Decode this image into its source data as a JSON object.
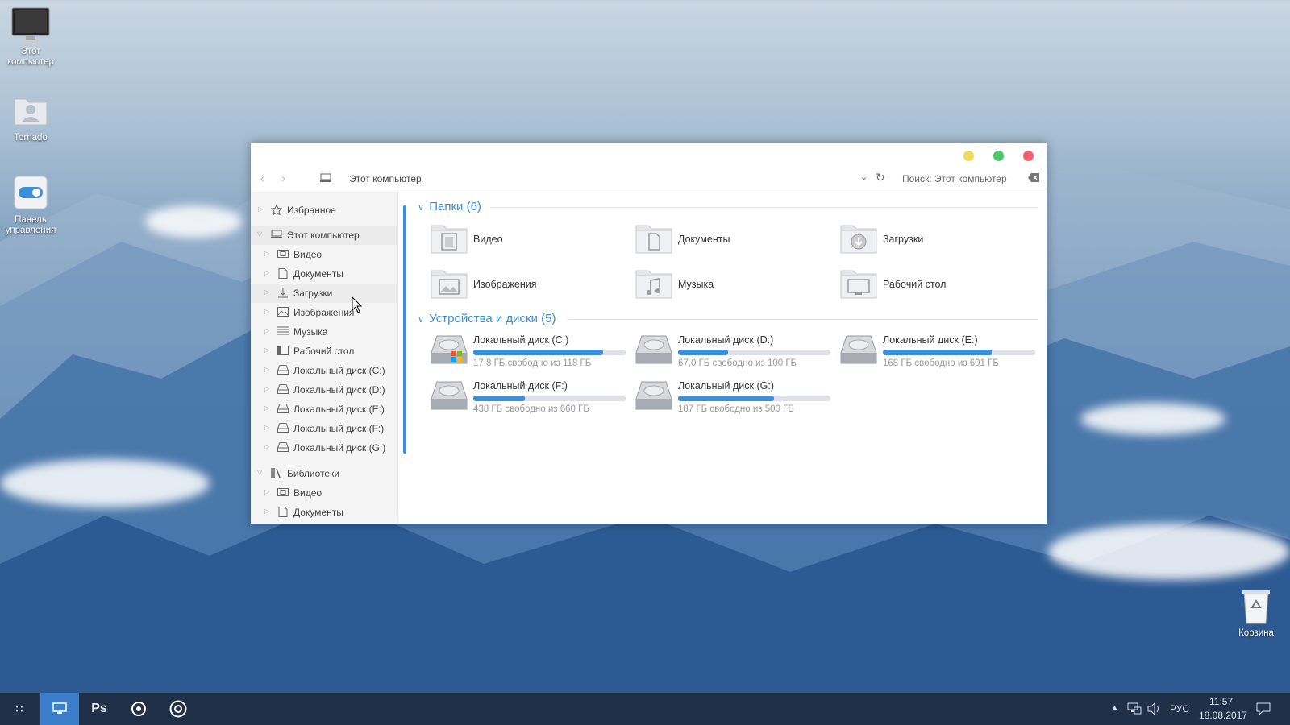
{
  "desktop": {
    "icons": [
      {
        "label": "Этот компьютер",
        "icon": "monitor-icon"
      },
      {
        "label": "Tornado",
        "icon": "user-folder-icon"
      },
      {
        "label": "Панель управления",
        "icon": "control-panel-toggle-icon"
      },
      {
        "label": "Корзина",
        "icon": "recycle-bin-icon"
      }
    ]
  },
  "window": {
    "controls": {
      "minimize_color": "#f1d95c",
      "maximize_color": "#4cc76a",
      "close_color": "#f0616d"
    },
    "address": "Этот компьютер",
    "search_placeholder": "Поиск: Этот компьютер"
  },
  "sidebar": {
    "items": [
      {
        "label": "Избранное",
        "icon": "star-icon",
        "level": 0
      },
      {
        "label": "Этот компьютер",
        "icon": "computer-icon",
        "level": 0,
        "expanded": true,
        "selected": true
      },
      {
        "label": "Видео",
        "icon": "film-icon",
        "level": 1
      },
      {
        "label": "Документы",
        "icon": "document-icon",
        "level": 1
      },
      {
        "label": "Загрузки",
        "icon": "download-icon",
        "level": 1,
        "hovered": true
      },
      {
        "label": "Изображения",
        "icon": "image-icon",
        "level": 1
      },
      {
        "label": "Музыка",
        "icon": "music-icon",
        "level": 1
      },
      {
        "label": "Рабочий стол",
        "icon": "desktop-icon",
        "level": 1
      },
      {
        "label": "Локальный диск (C:)",
        "icon": "drive-icon",
        "level": 1
      },
      {
        "label": "Локальный диск (D:)",
        "icon": "drive-icon",
        "level": 1
      },
      {
        "label": "Локальный диск (E:)",
        "icon": "drive-icon",
        "level": 1
      },
      {
        "label": "Локальный диск (F:)",
        "icon": "drive-icon",
        "level": 1
      },
      {
        "label": "Локальный диск (G:)",
        "icon": "drive-icon",
        "level": 1
      },
      {
        "label": "Библиотеки",
        "icon": "library-icon",
        "level": 0,
        "expanded": true
      },
      {
        "label": "Видео",
        "icon": "film-icon",
        "level": 1
      },
      {
        "label": "Документы",
        "icon": "document-icon",
        "level": 1
      }
    ]
  },
  "folders_group": {
    "title": "Папки (6)",
    "items": [
      {
        "label": "Видео",
        "icon": "video-folder-icon"
      },
      {
        "label": "Документы",
        "icon": "documents-folder-icon"
      },
      {
        "label": "Загрузки",
        "icon": "downloads-folder-icon"
      },
      {
        "label": "Изображения",
        "icon": "pictures-folder-icon"
      },
      {
        "label": "Музыка",
        "icon": "music-folder-icon"
      },
      {
        "label": "Рабочий стол",
        "icon": "desktop-folder-icon"
      }
    ]
  },
  "drives_group": {
    "title": "Устройства и диски (5)",
    "items": [
      {
        "name": "Локальный диск (C:)",
        "free": "17,8 ГБ свободно из 118 ГБ",
        "used_fraction": 0.85,
        "system": true
      },
      {
        "name": "Локальный диск (D:)",
        "free": "67,0 ГБ свободно из 100 ГБ",
        "used_fraction": 0.33
      },
      {
        "name": "Локальный диск (E:)",
        "free": "168 ГБ свободно из 601 ГБ",
        "used_fraction": 0.72
      },
      {
        "name": "Локальный диск (F:)",
        "free": "438 ГБ свободно из 660 ГБ",
        "used_fraction": 0.34
      },
      {
        "name": "Локальный диск (G:)",
        "free": "187 ГБ свободно из 500 ГБ",
        "used_fraction": 0.63
      }
    ]
  },
  "taskbar": {
    "start_icon": "apps-grid-icon",
    "apps": [
      {
        "icon": "show-desktop-icon",
        "active": true
      },
      {
        "label": "Ps",
        "icon": "photoshop-icon"
      },
      {
        "icon": "chrome-icon"
      },
      {
        "icon": "target-app-icon"
      }
    ],
    "tray": {
      "language": "РУС",
      "time": "11:57",
      "date": "18.08.2017"
    }
  }
}
